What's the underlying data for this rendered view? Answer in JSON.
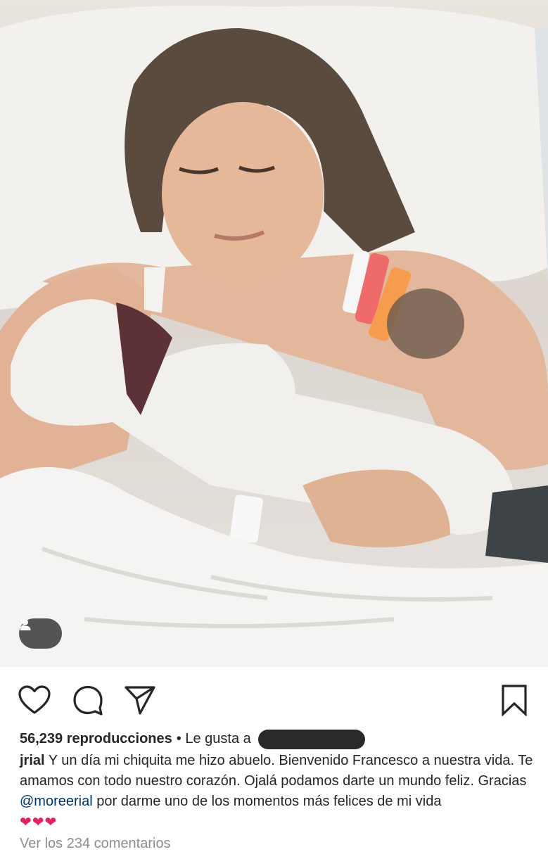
{
  "post": {
    "media": {
      "description_icon": "photo",
      "tag_indicator_icon": "user-tag-icon"
    },
    "actions": {
      "like_icon": "heart-outline-icon",
      "comment_icon": "comment-bubble-icon",
      "share_icon": "paper-plane-icon",
      "save_icon": "bookmark-outline-icon"
    },
    "stats": {
      "views": "56,239 reproducciones",
      "liked_by_prefix": "• Le gusta a"
    },
    "caption": {
      "username": "jrial",
      "text_before_mention": " Y un día mi chiquita me hizo abuelo. Bienvenido Francesco a nuestra vida. Te amamos con todo nuestro corazón. Ojalá podamos darte un mundo feliz. Gracias ",
      "mention": "@moreerial",
      "text_after_mention": " por darme uno de los momentos más felices de mi vida",
      "hearts": "❤❤❤"
    },
    "comments_link": "Ver los 234 comentarios"
  },
  "colors": {
    "text": "#262626",
    "mention": "#003569",
    "heart": "#e0245e",
    "muted": "#8e8e8e"
  }
}
